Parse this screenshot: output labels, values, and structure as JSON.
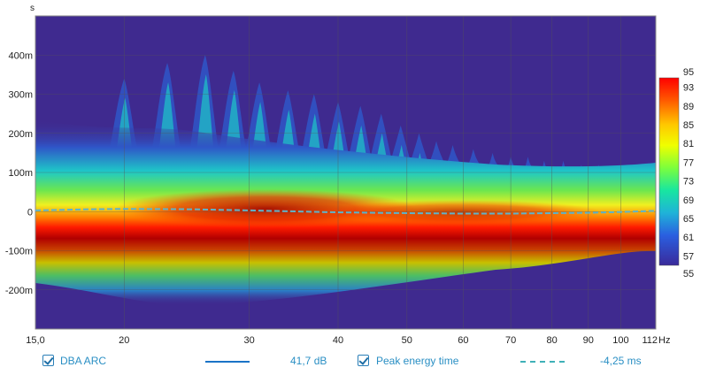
{
  "chart_data": {
    "type": "heatmap",
    "title": "",
    "ylabel": "s",
    "xlabel_unit": "Hz",
    "x_scale": "log",
    "xlim": [
      15,
      112
    ],
    "ylim": [
      -0.3,
      0.5
    ],
    "x_ticks": [
      {
        "value": 15,
        "label": "15,0"
      },
      {
        "value": 20,
        "label": "20"
      },
      {
        "value": 30,
        "label": "30"
      },
      {
        "value": 40,
        "label": "40"
      },
      {
        "value": 50,
        "label": "50"
      },
      {
        "value": 60,
        "label": "60"
      },
      {
        "value": 70,
        "label": "70"
      },
      {
        "value": 80,
        "label": "80"
      },
      {
        "value": 90,
        "label": "90"
      },
      {
        "value": 100,
        "label": "100"
      },
      {
        "value": 112,
        "label": "112"
      }
    ],
    "y_ticks": [
      {
        "value": 0.4,
        "label": "400m"
      },
      {
        "value": 0.3,
        "label": "300m"
      },
      {
        "value": 0.2,
        "label": "200m"
      },
      {
        "value": 0.1,
        "label": "100m"
      },
      {
        "value": 0.0,
        "label": "0"
      },
      {
        "value": -0.1,
        "label": "-100m"
      },
      {
        "value": -0.2,
        "label": "-200m"
      }
    ],
    "grid": true,
    "colorbar": {
      "min": 55,
      "max": 95,
      "tick_labels": [
        "95",
        "93",
        "89",
        "85",
        "81",
        "77",
        "73",
        "69",
        "65",
        "61",
        "57",
        "55"
      ],
      "tick_values": [
        95,
        93,
        89,
        85,
        81,
        77,
        73,
        69,
        65,
        61,
        57,
        55
      ]
    },
    "series": [
      {
        "name": "Peak energy time",
        "type": "line",
        "style": "dashed",
        "color": "#5fb3c9",
        "points": [
          [
            15,
            0.003
          ],
          [
            18,
            0.006
          ],
          [
            20,
            0.007
          ],
          [
            25,
            0.006
          ],
          [
            30,
            0.003
          ],
          [
            40,
            -0.002
          ],
          [
            50,
            -0.004
          ],
          [
            60,
            -0.005
          ],
          [
            70,
            -0.005
          ],
          [
            80,
            -0.004
          ],
          [
            90,
            -0.003
          ],
          [
            100,
            -0.001
          ],
          [
            112,
            0.002
          ]
        ]
      }
    ]
  },
  "legend": {
    "items": [
      {
        "label": "DBA ARC",
        "value": "41,7 dB",
        "color": "#1a73c7",
        "style": "solid"
      },
      {
        "label": "Peak energy time",
        "value": "-4,25 ms",
        "color": "#3fb0b8",
        "style": "dashed"
      }
    ]
  }
}
